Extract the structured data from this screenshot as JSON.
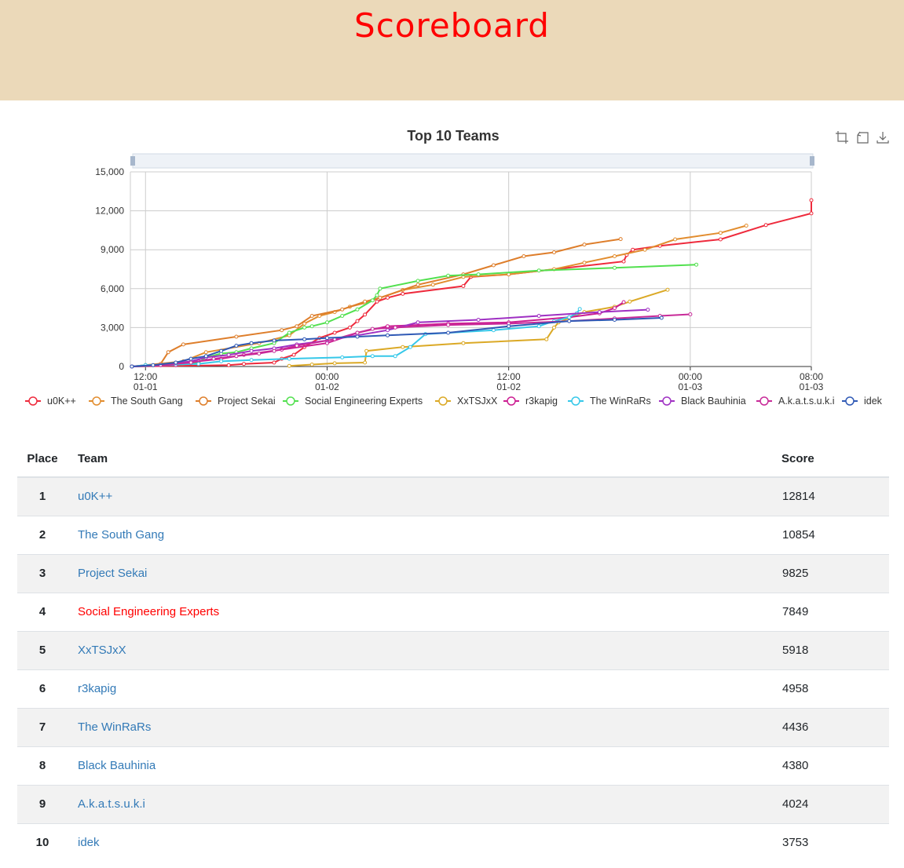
{
  "page": {
    "title": "Scoreboard"
  },
  "chart_data": {
    "type": "line",
    "title": "Top 10 Teams",
    "xlabel": "",
    "ylabel": "",
    "ylim": [
      0,
      15000
    ],
    "yticks": [
      "0",
      "3,000",
      "6,000",
      "9,000",
      "12,000",
      "15,000"
    ],
    "xticks": [
      {
        "t": 4,
        "line1": "12:00",
        "line2": "01-01"
      },
      {
        "t": 16,
        "line1": "00:00",
        "line2": "01-02"
      },
      {
        "t": 28,
        "line1": "12:00",
        "line2": "01-02"
      },
      {
        "t": 40,
        "line1": "00:00",
        "line2": "01-03"
      },
      {
        "t": 48,
        "line1": "08:00",
        "line2": "01-03"
      }
    ],
    "xlim": [
      3,
      48
    ],
    "x_unit": "hours since 2023-01-01 08:00",
    "grid": true,
    "legend_position": "bottom",
    "series": [
      {
        "name": "u0K++",
        "color": "#ee2a3c",
        "points": [
          [
            3.1,
            0
          ],
          [
            9.5,
            100
          ],
          [
            10.5,
            200
          ],
          [
            12.5,
            300
          ],
          [
            13,
            600
          ],
          [
            13.8,
            900
          ],
          [
            14.5,
            1500
          ],
          [
            15.5,
            2200
          ],
          [
            16.5,
            2600
          ],
          [
            17.5,
            3000
          ],
          [
            18,
            3500
          ],
          [
            18.5,
            4000
          ],
          [
            19.3,
            5000
          ],
          [
            20,
            5300
          ],
          [
            21,
            5600
          ],
          [
            25,
            6200
          ],
          [
            25.5,
            6900
          ],
          [
            28,
            7100
          ],
          [
            35.6,
            8100
          ],
          [
            35.8,
            8600
          ],
          [
            36.2,
            9000
          ],
          [
            38,
            9300
          ],
          [
            42,
            9800
          ],
          [
            45,
            10900
          ],
          [
            48,
            11800
          ],
          [
            48,
            12814
          ]
        ]
      },
      {
        "name": "The South Gang",
        "color": "#e28d2f",
        "points": [
          [
            3.1,
            0
          ],
          [
            4,
            100
          ],
          [
            6.5,
            400
          ],
          [
            8,
            1100
          ],
          [
            11.5,
            1800
          ],
          [
            13.5,
            2400
          ],
          [
            14.5,
            3300
          ],
          [
            15.5,
            3900
          ],
          [
            16.5,
            4200
          ],
          [
            17.5,
            4600
          ],
          [
            18.5,
            4900
          ],
          [
            19.5,
            5300
          ],
          [
            21,
            5900
          ],
          [
            23,
            6300
          ],
          [
            25,
            6900
          ],
          [
            28,
            7100
          ],
          [
            31,
            7500
          ],
          [
            33,
            8000
          ],
          [
            35,
            8500
          ],
          [
            37,
            9000
          ],
          [
            39,
            9800
          ],
          [
            42,
            10300
          ],
          [
            43.7,
            10854
          ]
        ]
      },
      {
        "name": "Project Sekai",
        "color": "#de7e2b",
        "points": [
          [
            3.1,
            0
          ],
          [
            4,
            100
          ],
          [
            5,
            200
          ],
          [
            5.5,
            1100
          ],
          [
            6.5,
            1700
          ],
          [
            10,
            2300
          ],
          [
            13,
            2800
          ],
          [
            14,
            3100
          ],
          [
            15,
            3900
          ],
          [
            17,
            4400
          ],
          [
            18.5,
            5000
          ],
          [
            19.5,
            5300
          ],
          [
            22,
            6300
          ],
          [
            25,
            7100
          ],
          [
            27,
            7800
          ],
          [
            29,
            8500
          ],
          [
            31,
            8800
          ],
          [
            33,
            9400
          ],
          [
            35.4,
            9825
          ]
        ]
      },
      {
        "name": "Social Engineering Experts",
        "color": "#52e04f",
        "points": [
          [
            3.1,
            0
          ],
          [
            6,
            100
          ],
          [
            7.5,
            300
          ],
          [
            8,
            700
          ],
          [
            9,
            1000
          ],
          [
            10,
            1100
          ],
          [
            11,
            1400
          ],
          [
            12.5,
            1800
          ],
          [
            13.5,
            2600
          ],
          [
            14.5,
            3000
          ],
          [
            15,
            3100
          ],
          [
            16,
            3400
          ],
          [
            17,
            3900
          ],
          [
            18,
            4400
          ],
          [
            19,
            5100
          ],
          [
            19.3,
            5500
          ],
          [
            19.5,
            6000
          ],
          [
            22,
            6600
          ],
          [
            24,
            7000
          ],
          [
            26,
            7100
          ],
          [
            30,
            7400
          ],
          [
            35,
            7600
          ],
          [
            40.4,
            7849
          ]
        ]
      },
      {
        "name": "XxTSJxX",
        "color": "#dba926",
        "points": [
          [
            13.5,
            50
          ],
          [
            15,
            150
          ],
          [
            16.5,
            250
          ],
          [
            18.5,
            300
          ],
          [
            18.6,
            1200
          ],
          [
            21,
            1500
          ],
          [
            25,
            1800
          ],
          [
            30.5,
            2100
          ],
          [
            31,
            3000
          ],
          [
            31.3,
            3400
          ],
          [
            33,
            4200
          ],
          [
            35,
            4600
          ],
          [
            36,
            5000
          ],
          [
            38.5,
            5918
          ]
        ]
      },
      {
        "name": "r3kapig",
        "color": "#cc1d92",
        "points": [
          [
            3.1,
            0
          ],
          [
            6,
            100
          ],
          [
            7.5,
            400
          ],
          [
            9,
            600
          ],
          [
            10.5,
            900
          ],
          [
            13,
            1300
          ],
          [
            16,
            1800
          ],
          [
            18,
            2600
          ],
          [
            20,
            3100
          ],
          [
            24,
            3300
          ],
          [
            28,
            3400
          ],
          [
            32,
            3800
          ],
          [
            34,
            4100
          ],
          [
            35,
            4500
          ],
          [
            35.6,
            4958
          ]
        ]
      },
      {
        "name": "The WinRaRs",
        "color": "#36c8e9",
        "points": [
          [
            3.1,
            0
          ],
          [
            4,
            100
          ],
          [
            7.5,
            200
          ],
          [
            9,
            400
          ],
          [
            11,
            500
          ],
          [
            13.5,
            600
          ],
          [
            17,
            700
          ],
          [
            19,
            800
          ],
          [
            20.5,
            800
          ],
          [
            21.5,
            1500
          ],
          [
            22.5,
            2500
          ],
          [
            27,
            2800
          ],
          [
            30,
            3100
          ],
          [
            31,
            3500
          ],
          [
            32,
            3800
          ],
          [
            32.5,
            4100
          ],
          [
            32.7,
            4436
          ]
        ]
      },
      {
        "name": "Black Bauhinia",
        "color": "#9f30c3",
        "points": [
          [
            3.1,
            0
          ],
          [
            5,
            100
          ],
          [
            7,
            400
          ],
          [
            8,
            700
          ],
          [
            9.5,
            900
          ],
          [
            11,
            1200
          ],
          [
            12.5,
            1400
          ],
          [
            14,
            1700
          ],
          [
            16,
            2000
          ],
          [
            18,
            2400
          ],
          [
            20,
            2800
          ],
          [
            22,
            3400
          ],
          [
            26,
            3600
          ],
          [
            30,
            3900
          ],
          [
            34,
            4200
          ],
          [
            37.2,
            4380
          ]
        ]
      },
      {
        "name": "A.k.a.t.s.u.k.i",
        "color": "#c82a98",
        "points": [
          [
            3.1,
            0
          ],
          [
            5,
            100
          ],
          [
            7,
            300
          ],
          [
            8.5,
            600
          ],
          [
            10,
            800
          ],
          [
            11.5,
            1000
          ],
          [
            12.5,
            1200
          ],
          [
            14,
            1600
          ],
          [
            16.5,
            2100
          ],
          [
            18,
            2600
          ],
          [
            19,
            2900
          ],
          [
            20.5,
            3000
          ],
          [
            24,
            3200
          ],
          [
            28,
            3300
          ],
          [
            32,
            3500
          ],
          [
            35,
            3700
          ],
          [
            38,
            3900
          ],
          [
            40,
            4024
          ]
        ]
      },
      {
        "name": "idek",
        "color": "#2f59b5",
        "points": [
          [
            3.1,
            0
          ],
          [
            4.5,
            100
          ],
          [
            6,
            300
          ],
          [
            7,
            600
          ],
          [
            8,
            800
          ],
          [
            9,
            1200
          ],
          [
            10,
            1600
          ],
          [
            11,
            1800
          ],
          [
            12.5,
            2000
          ],
          [
            14.5,
            2100
          ],
          [
            16,
            2200
          ],
          [
            18,
            2300
          ],
          [
            20,
            2400
          ],
          [
            24,
            2600
          ],
          [
            28,
            3100
          ],
          [
            32,
            3500
          ],
          [
            35,
            3600
          ],
          [
            38.1,
            3753
          ]
        ]
      }
    ]
  },
  "table": {
    "headers": {
      "place": "Place",
      "team": "Team",
      "score": "Score"
    },
    "rows": [
      {
        "place": "1",
        "team": "u0K++",
        "score": "12814"
      },
      {
        "place": "2",
        "team": "The South Gang",
        "score": "10854"
      },
      {
        "place": "3",
        "team": "Project Sekai",
        "score": "9825"
      },
      {
        "place": "4",
        "team": "Social Engineering Experts",
        "score": "7849",
        "highlight": true
      },
      {
        "place": "5",
        "team": "XxTSJxX",
        "score": "5918"
      },
      {
        "place": "6",
        "team": "r3kapig",
        "score": "4958"
      },
      {
        "place": "7",
        "team": "The WinRaRs",
        "score": "4436"
      },
      {
        "place": "8",
        "team": "Black Bauhinia",
        "score": "4380"
      },
      {
        "place": "9",
        "team": "A.k.a.t.s.u.k.i",
        "score": "4024"
      },
      {
        "place": "10",
        "team": "idek",
        "score": "3753"
      }
    ]
  },
  "toolbox": {
    "icons": [
      "zoom-icon",
      "restore-icon",
      "download-icon"
    ]
  }
}
